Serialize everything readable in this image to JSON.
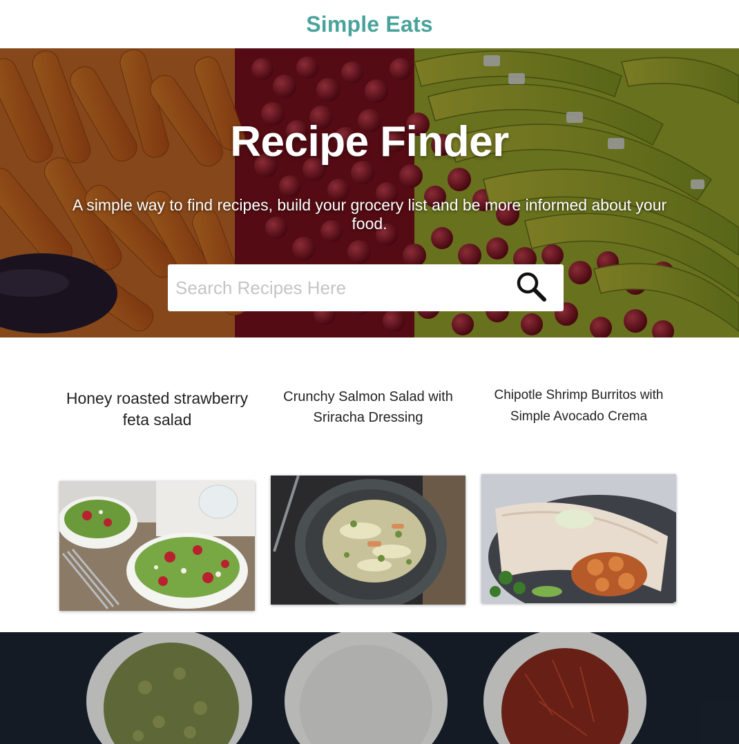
{
  "header": {
    "brand": "Simple Eats"
  },
  "hero": {
    "title": "Recipe Finder",
    "subtitle": "A simple way to find recipes, build your grocery list and be more informed about your food.",
    "search": {
      "placeholder": "Search Recipes Here",
      "value": "",
      "icon": "search-icon"
    }
  },
  "recipes": [
    {
      "title": "Honey roasted strawberry feta salad"
    },
    {
      "title": "Crunchy Salmon Salad with Sriracha Dressing"
    },
    {
      "title": "Chipotle Shrimp Burritos with Simple Avocado Crema"
    }
  ],
  "colors": {
    "brand": "#4aa39b",
    "hero_overlay": "#000000",
    "spice_band": "#1b2430"
  }
}
